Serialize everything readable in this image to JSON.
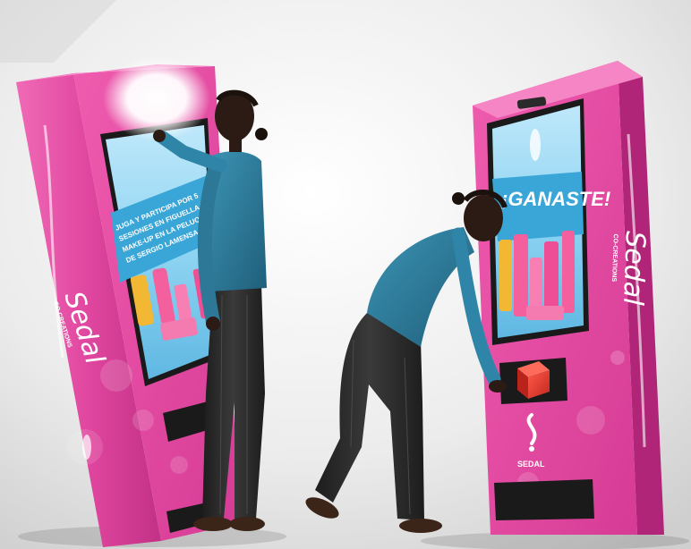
{
  "kiosk_left": {
    "screen_promo_lines": [
      "JUGA Y PARTICIPA POR 5",
      "SESIONES EN FIGUELLA Y U",
      "MAKE-UP EN LA PELUQUERÍA",
      "DE SERGIO LAMENSA"
    ],
    "brand_name": "Sedal",
    "brand_tagline": "CO-CREATIONS"
  },
  "kiosk_right": {
    "screen_headline": "¡GANASTE!",
    "brand_name": "Sedal",
    "brand_tagline": "CO-CREATIONS",
    "logo_text": "SEDAL"
  },
  "colors": {
    "kiosk_pink": "#e0469f",
    "kiosk_dark_pink": "#b02577",
    "screen_sky": "#8fd4f2",
    "screen_band": "#3aa6d8",
    "shirt_teal": "#2f7c9c",
    "pants_dark": "#2a2a2a",
    "prize_red": "#e6382d"
  }
}
